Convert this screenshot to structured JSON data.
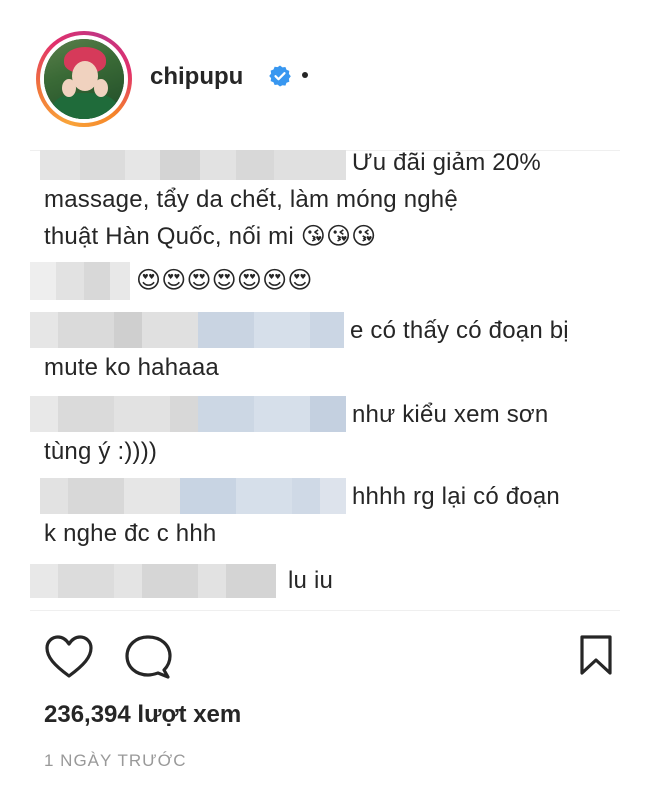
{
  "header": {
    "username": "chipupu",
    "verified_icon": "verified-badge-icon",
    "more_icon": "dot-icon"
  },
  "comments": [
    {
      "lines": [
        "Ưu đãi giảm 20%",
        "massage, tẩy da chết, làm móng nghệ",
        "thuật Hàn Quốc, nối mi 😘😘😘"
      ]
    },
    {
      "lines": [
        "😍😍😍😍😍😍😍"
      ]
    },
    {
      "lines": [
        "e có thấy có đoạn bị",
        "mute ko hahaaa"
      ]
    },
    {
      "lines": [
        "như kiểu xem sơn",
        "tùng ý :))))"
      ]
    },
    {
      "lines": [
        "hhhh rg lại có đoạn",
        "k nghe đc c hhh"
      ]
    },
    {
      "lines": [
        "lu iu"
      ]
    }
  ],
  "actions": {
    "like_icon": "heart-icon",
    "comment_icon": "comment-bubble-icon",
    "save_icon": "bookmark-icon"
  },
  "stats": {
    "views": "236,394 lượt xem",
    "time": "1 NGÀY TRƯỚC"
  },
  "colors": {
    "text": "#262626",
    "muted": "#999999",
    "verified": "#3897f0",
    "divider": "#efefef"
  }
}
